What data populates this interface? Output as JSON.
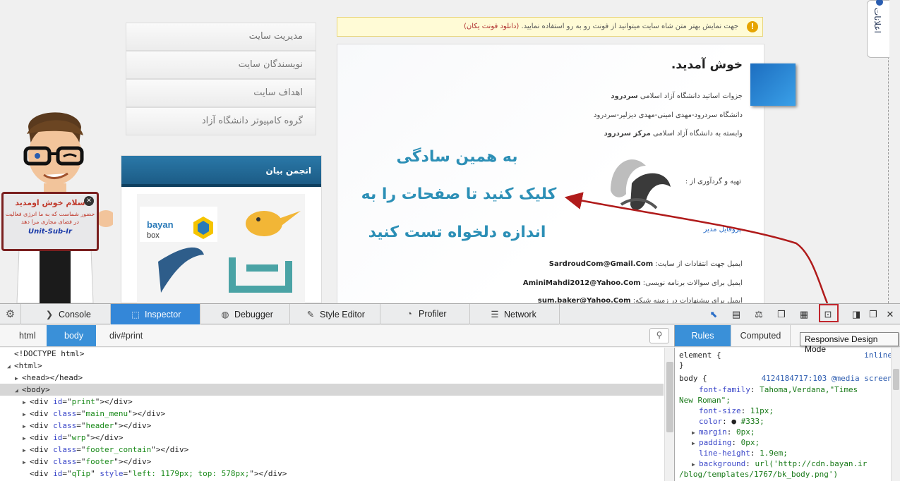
{
  "site": {
    "side_tab": "اعلانات",
    "menu": [
      "مدیریت سایت",
      "نویسندگان سایت",
      "اهداف سایت",
      "گروه کامپیوتر دانشگاه آزاد"
    ],
    "bayan_title": "انجمن بیان",
    "sign": {
      "line1": "سلام خوش اومدید",
      "line2": "حضور شماست که به ما انرژی فعالیت در فضای مجازی مرا دهد",
      "line3": "Unit-Sub-Ir"
    },
    "notice": {
      "text": "جهت نمایش بهتر متن شاه سایت میتوانید از فونت رو به رو استفاده نمایید.",
      "link": "(دانلود فونت یکان)"
    },
    "content": {
      "title": "خوش آمدید.",
      "line1_pre": "جزوات اساتید دانشگاه آزاد اسلامی ",
      "line1_bold": "سردرود",
      "line2": "دانشگاه سردرود-مهدی امینی-مهدی دیزلیر-سردرود",
      "line3_pre": "وابسته به دانشگاه آزاد اسلامی ",
      "line3_bold": "مرکز سردرود",
      "prep": "تهیه و گردآوری از :",
      "profile": "پروفایل مدیر",
      "email1_label": "ایمیل جهت انتقادات از سایت: ",
      "email1": "SardroudCom@Gmail.Com",
      "email2_label": "ایمیل برای سوالات برنامه نویسی: ",
      "email2": "AminiMahdi2012@Yahoo.Com",
      "email3_label": "ایمیل برای پیشنهادات در زمینه شبکه: ",
      "email3": "sum.baker@Yahoo.Com"
    },
    "overlay": [
      "به همین سادگی",
      "کلیک کنید تا صفحات را به",
      "اندازه دلخواه تست کنید"
    ]
  },
  "devtools": {
    "tabs": {
      "console": "Console",
      "inspector": "Inspector",
      "debugger": "Debugger",
      "style_editor": "Style Editor",
      "profiler": "Profiler",
      "network": "Network"
    },
    "tooltip": "Responsive Design Mode",
    "breadcrumbs": [
      "html",
      "body",
      "div#print"
    ],
    "markup": [
      {
        "indent": 0,
        "twisty": "",
        "text": "<!DOCTYPE html>"
      },
      {
        "indent": 0,
        "twisty": "◢",
        "text": "<html>"
      },
      {
        "indent": 1,
        "twisty": "▶",
        "text": "<head></head>"
      },
      {
        "indent": 1,
        "twisty": "◢",
        "text": "<body>",
        "selected": true
      },
      {
        "indent": 2,
        "twisty": "▶",
        "tag": "div",
        "attr": "id",
        "val": "print"
      },
      {
        "indent": 2,
        "twisty": "▶",
        "tag": "div",
        "attr": "class",
        "val": "main_menu"
      },
      {
        "indent": 2,
        "twisty": "▶",
        "tag": "div",
        "attr": "class",
        "val": "header"
      },
      {
        "indent": 2,
        "twisty": "▶",
        "tag": "div",
        "attr": "id",
        "val": "wrp"
      },
      {
        "indent": 2,
        "twisty": "▶",
        "tag": "div",
        "attr": "class",
        "val": "footer_contain"
      },
      {
        "indent": 2,
        "twisty": "▶",
        "tag": "div",
        "attr": "class",
        "val": "footer"
      },
      {
        "indent": 2,
        "twisty": "",
        "tag": "div",
        "attr": "id",
        "val": "qTip",
        "attr2": "style",
        "val2": "left: 1179px; top: 578px;"
      }
    ],
    "rules_tabs": {
      "rules": "Rules",
      "computed": "Computed"
    },
    "rules": {
      "element_sel": "element {",
      "element_src": "inline",
      "close": "}",
      "body_sel": "body {",
      "body_src": "4124184717:103 @media screen",
      "p1": "font-family",
      "v1a": "Tahoma,Verdana,\"Times",
      "v1b": "New Roman\";",
      "p2": "font-size",
      "v2": "11px;",
      "p3": "color",
      "v3": "#333;",
      "p4": "margin",
      "v4": "0px;",
      "p5": "padding",
      "v5": "0px;",
      "p6": "line-height",
      "v6": "1.9em;",
      "p7": "background",
      "v7a": "url('http://cdn.bayan.ir",
      "v7b": "/blog/templates/1767/bk_body.png')"
    }
  },
  "colors": {
    "accent": "#3487d8",
    "highlight": "#c0262d",
    "overlay_text": "#2c8fb6"
  }
}
